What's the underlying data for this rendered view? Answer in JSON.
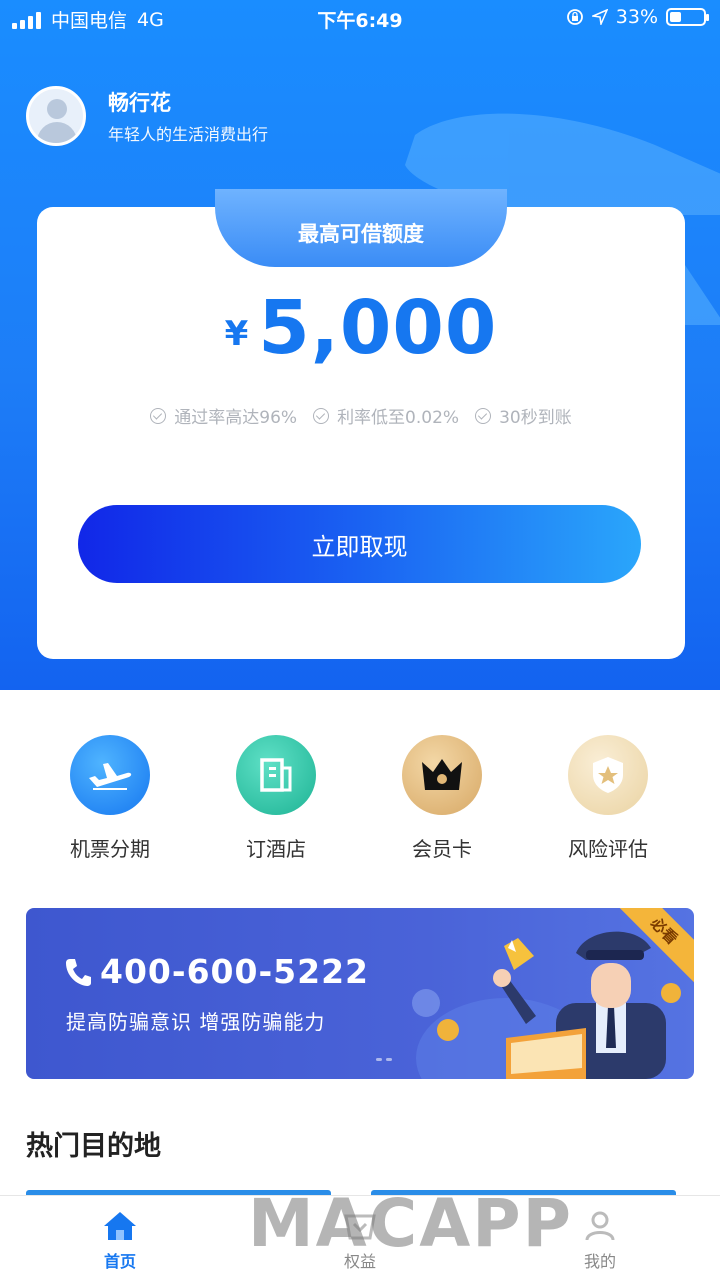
{
  "status_bar": {
    "carrier": "中国电信",
    "network": "4G",
    "time": "下午6:49",
    "battery": "33%"
  },
  "profile": {
    "name": "畅行花",
    "slogan": "年轻人的生活消费出行"
  },
  "credit_card": {
    "tab_title": "最高可借额度",
    "currency_symbol": "¥",
    "amount": "5,000",
    "features": [
      "通过率高达96%",
      "利率低至0.02%",
      "30秒到账"
    ],
    "cta_label": "立即取现"
  },
  "quick_menu": [
    {
      "label": "机票分期",
      "icon": "airplane-icon"
    },
    {
      "label": "订酒店",
      "icon": "hotel-icon"
    },
    {
      "label": "会员卡",
      "icon": "crown-icon"
    },
    {
      "label": "风险评估",
      "icon": "shield-star-icon"
    }
  ],
  "banner": {
    "phone": "400-600-5222",
    "tagline": "提高防骗意识  增强防骗能力",
    "corner_badge": "必看"
  },
  "hot_destinations": {
    "title": "热门目的地"
  },
  "tab_bar": [
    {
      "label": "首页",
      "icon": "home-icon",
      "active": true
    },
    {
      "label": "权益",
      "icon": "benefits-icon",
      "active": false
    },
    {
      "label": "我的",
      "icon": "profile-icon",
      "active": false
    }
  ],
  "watermark": "MACAPP",
  "colors": {
    "brand_blue": "#1677f0",
    "header_blue": "#1a8dff",
    "banner_blue": "#4a63d8",
    "gold": "#d7a865"
  }
}
